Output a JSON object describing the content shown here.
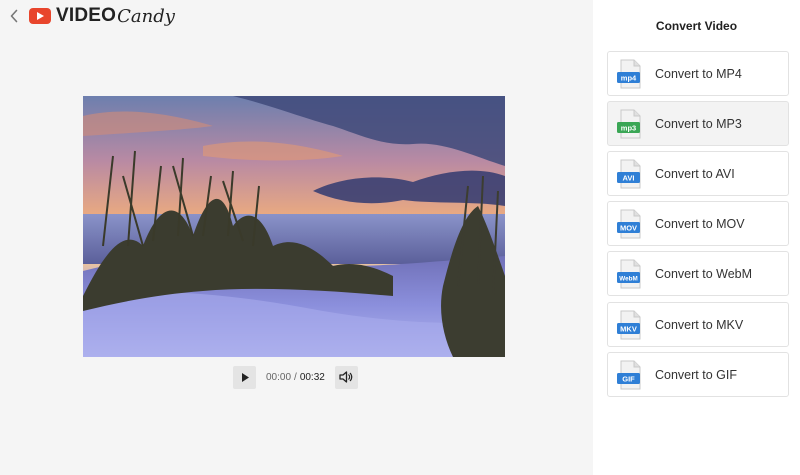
{
  "header": {
    "logo_video": "VIDEO",
    "logo_candy": "Candy"
  },
  "player": {
    "current_time": "00:00",
    "separator": "/",
    "total_time": "00:32"
  },
  "panel": {
    "title": "Convert Video",
    "items": [
      {
        "label": "Convert to MP4",
        "badge": "mp4",
        "color": "#2f7fd6"
      },
      {
        "label": "Convert to MP3",
        "badge": "mp3",
        "color": "#3aa655"
      },
      {
        "label": "Convert to AVI",
        "badge": "AVI",
        "color": "#2f7fd6"
      },
      {
        "label": "Convert to MOV",
        "badge": "MOV",
        "color": "#2f7fd6"
      },
      {
        "label": "Convert to WebM",
        "badge": "WebM",
        "color": "#2f7fd6"
      },
      {
        "label": "Convert to MKV",
        "badge": "MKV",
        "color": "#2f7fd6"
      },
      {
        "label": "Convert to GIF",
        "badge": "GIF",
        "color": "#2f7fd6"
      }
    ]
  },
  "colors": {
    "brand": "#e8452c",
    "sidebar_bg": "#ffffff",
    "main_bg": "#f5f5f5"
  }
}
